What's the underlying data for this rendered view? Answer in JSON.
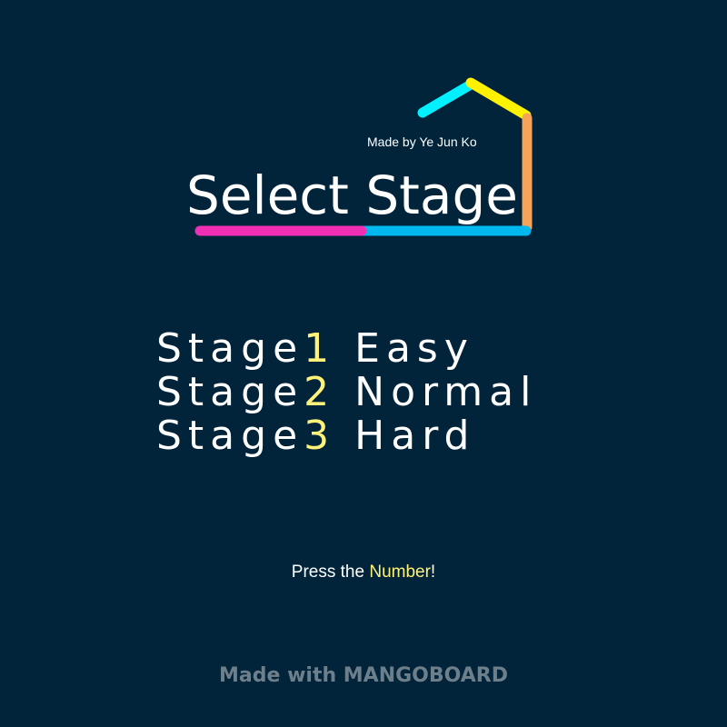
{
  "credit": "Made by Ye Jun Ko",
  "title": "Select Stage",
  "stages": [
    {
      "word": "Stage",
      "number": "1",
      "difficulty": "Easy"
    },
    {
      "word": "Stage",
      "number": "2",
      "difficulty": "Normal"
    },
    {
      "word": "Stage",
      "number": "3",
      "difficulty": "Hard"
    }
  ],
  "prompt": {
    "before": "Press the ",
    "highlight": "Number",
    "after": "!"
  },
  "footer": "Made with MANGOBOARD",
  "colors": {
    "background": "#01243a",
    "number_highlight": "#fff27a",
    "line_cyan": "#00f0ff",
    "line_yellow": "#fff200",
    "line_orange": "#f7a35a",
    "line_magenta": "#f12fb5",
    "line_blue": "#00b8f0"
  }
}
